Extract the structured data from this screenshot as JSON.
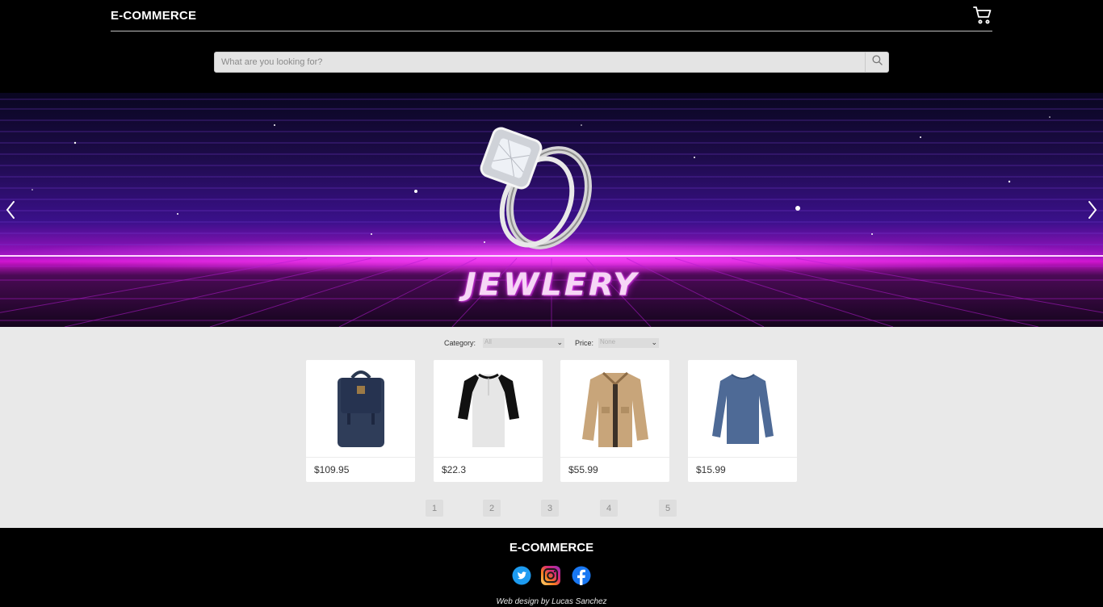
{
  "header": {
    "brand": "E-COMMERCE",
    "cart_icon": "shopping-cart-icon"
  },
  "search": {
    "placeholder": "What are you looking for?",
    "value": "",
    "icon": "search-icon"
  },
  "banner": {
    "title": "JEWLERY",
    "prev_icon": "chevron-left-icon",
    "next_icon": "chevron-right-icon",
    "accent": "#d014d0"
  },
  "filters": {
    "category_label": "Category:",
    "category_value": "All",
    "price_label": "Price:",
    "price_value": "None"
  },
  "products": [
    {
      "price": "$109.95",
      "image": "backpack"
    },
    {
      "price": "$22.3",
      "image": "raglan-shirt"
    },
    {
      "price": "$55.99",
      "image": "jacket"
    },
    {
      "price": "$15.99",
      "image": "long-sleeve-shirt"
    }
  ],
  "pagination": [
    "1",
    "2",
    "3",
    "4",
    "5"
  ],
  "footer": {
    "brand": "E-COMMERCE",
    "social": [
      "twitter-icon",
      "instagram-icon",
      "facebook-icon"
    ],
    "credit": "Web design by Lucas Sanchez"
  }
}
